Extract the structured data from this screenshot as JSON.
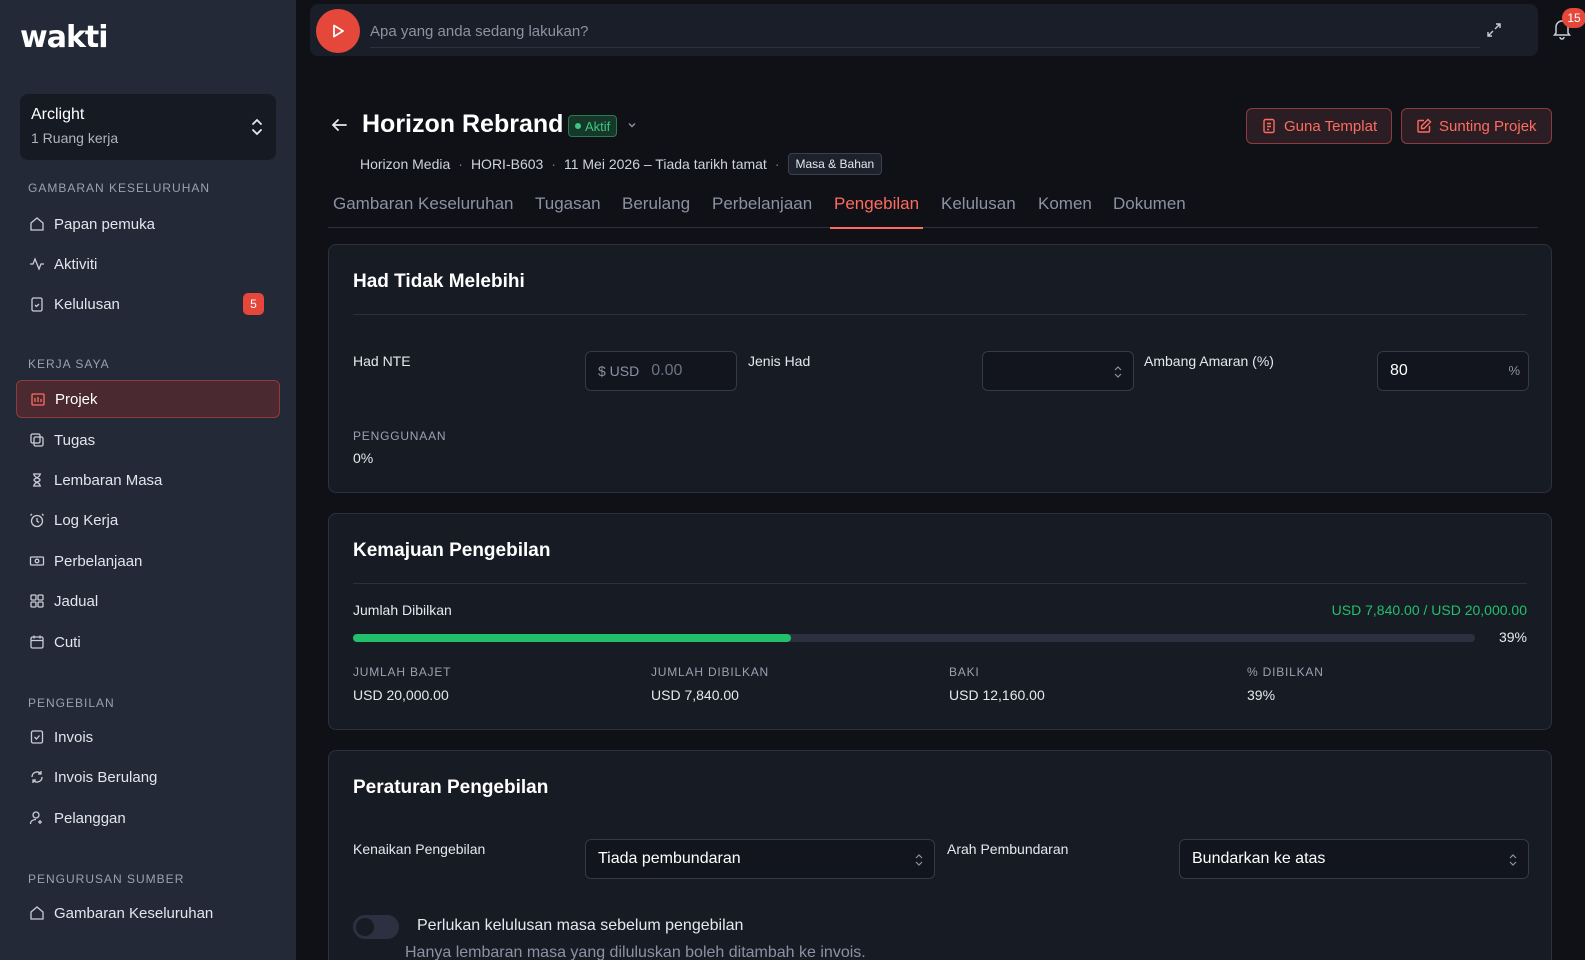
{
  "app": {
    "logo": "wakti"
  },
  "workspace": {
    "name": "Arclight",
    "subtitle": "1 Ruang kerja"
  },
  "sidebar": {
    "sections": [
      {
        "title": "GAMBARAN KESELURUHAN"
      },
      {
        "title": "KERJA SAYA"
      },
      {
        "title": "PENGEBILAN"
      },
      {
        "title": "PENGURUSAN SUMBER"
      }
    ],
    "items": [
      {
        "label": "Papan pemuka",
        "icon": "home-icon"
      },
      {
        "label": "Aktiviti",
        "icon": "activity-icon"
      },
      {
        "label": "Kelulusan",
        "icon": "clipboard-check-icon",
        "badge": "5"
      },
      {
        "label": "Projek",
        "icon": "project-icon",
        "active": true
      },
      {
        "label": "Tugas",
        "icon": "tasks-icon"
      },
      {
        "label": "Lembaran Masa",
        "icon": "hourglass-icon"
      },
      {
        "label": "Log Kerja",
        "icon": "clock-icon"
      },
      {
        "label": "Perbelanjaan",
        "icon": "cash-icon"
      },
      {
        "label": "Jadual",
        "icon": "grid-icon"
      },
      {
        "label": "Cuti",
        "icon": "calendar-icon"
      },
      {
        "label": "Invois",
        "icon": "invoice-icon"
      },
      {
        "label": "Invois Berulang",
        "icon": "refresh-icon"
      },
      {
        "label": "Pelanggan",
        "icon": "users-icon"
      },
      {
        "label": "Gambaran Keseluruhan",
        "icon": "home-icon"
      }
    ]
  },
  "topbar": {
    "placeholder": "Apa yang anda sedang lakukan?",
    "notifications": "15"
  },
  "project": {
    "title": "Horizon Rebrand",
    "status": "Aktif",
    "client": "Horizon Media",
    "code": "HORI-B603",
    "dates": "11 Mei 2026 – Tiada tarikh tamat",
    "type_tag": "Masa & Bahan",
    "use_template": "Guna Templat",
    "edit_project": "Sunting Projek"
  },
  "tabs": [
    {
      "label": "Gambaran Keseluruhan"
    },
    {
      "label": "Tugasan"
    },
    {
      "label": "Berulang"
    },
    {
      "label": "Perbelanjaan"
    },
    {
      "label": "Pengebilan",
      "active": true
    },
    {
      "label": "Kelulusan"
    },
    {
      "label": "Komen"
    },
    {
      "label": "Dokumen"
    }
  ],
  "nte": {
    "title": "Had Tidak Melebihi",
    "had_label": "Had NTE",
    "currency": "$ USD",
    "amount_placeholder": "0.00",
    "jenis_label": "Jenis Had",
    "jenis_value": "",
    "ambang_label": "Ambang Amaran (%)",
    "ambang_value": "80",
    "percent_sign": "%",
    "usage_label": "PENGGUNAAN",
    "usage_value": "0%"
  },
  "progress": {
    "title": "Kemajuan Pengebilan",
    "label": "Jumlah Dibilkan",
    "amount": "USD 7,840.00 / USD 20,000.00",
    "percent_text": "39%",
    "fraction": 0.39,
    "fill_color": "#22c06a",
    "stats": [
      {
        "label": "JUMLAH BAJET",
        "value": "USD 20,000.00"
      },
      {
        "label": "JUMLAH DIBILKAN",
        "value": "USD 7,840.00"
      },
      {
        "label": "BAKI",
        "value": "USD 12,160.00"
      },
      {
        "label": "% DIBILKAN",
        "value": "39%"
      }
    ]
  },
  "rules": {
    "title": "Peraturan Pengebilan",
    "increment_label": "Kenaikan Pengebilan",
    "increment_value": "Tiada pembundaran",
    "direction_label": "Arah Pembundaran",
    "direction_value": "Bundarkan ke atas",
    "toggle_label": "Perlukan kelulusan masa sebelum pengebilan",
    "toggle_help": "Hanya lembaran masa yang diluluskan boleh ditambah ke invois."
  },
  "colors": {
    "accent": "#ff6b5f",
    "danger": "#e5483a",
    "success": "#22c06a"
  }
}
